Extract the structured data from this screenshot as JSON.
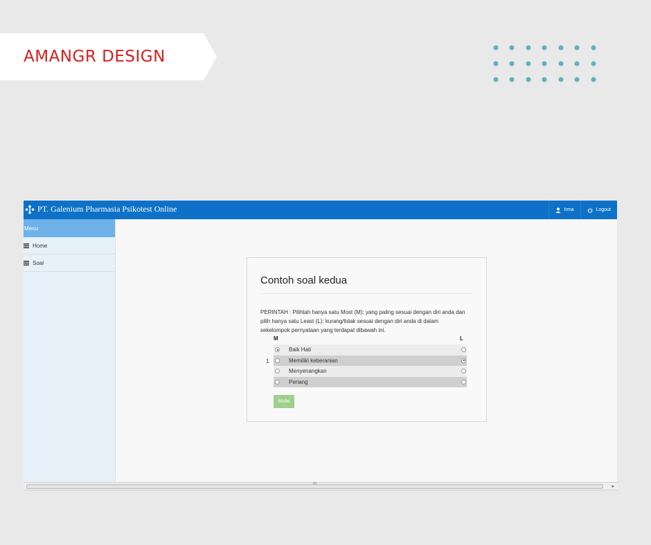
{
  "banner": {
    "text": "AMANGR DESIGN",
    "text_color": "#d21f1f"
  },
  "dots_color": "#5fb3b8",
  "app": {
    "topbar_color": "#0d72c7",
    "brand": "PT. Galenium Pharmasia Psikotest Online",
    "user": "Irma",
    "logout": "Logout"
  },
  "sidebar": {
    "header": "Menu",
    "items": [
      {
        "label": "Home",
        "icon": "list-icon"
      },
      {
        "label": "Soal",
        "icon": "list-icon"
      }
    ]
  },
  "card": {
    "title": "Contoh soal kedua",
    "instruction": "PERINTAH : Pilihlah hanya satu Most (M): yang paling sesuai dengan diri anda dan pilih hanya satu Least (L): kurang/tidak sesuai dengan diri anda di dalam sekelompok pernyataan yang terdapat dibawah ini.",
    "col_m": "M",
    "col_l": "L",
    "question_number": "1",
    "options": [
      {
        "label": "Baik Hati",
        "m_selected": true,
        "l_selected": false
      },
      {
        "label": "Memiliki keberanian",
        "m_selected": false,
        "l_selected": true
      },
      {
        "label": "Menyenangkan",
        "m_selected": false,
        "l_selected": false
      },
      {
        "label": "Periang",
        "m_selected": false,
        "l_selected": false
      }
    ],
    "start_button": "Mulai",
    "start_button_color": "#9fcf8c"
  },
  "scrollbar": {
    "grip": "III",
    "arrow": "▸"
  }
}
